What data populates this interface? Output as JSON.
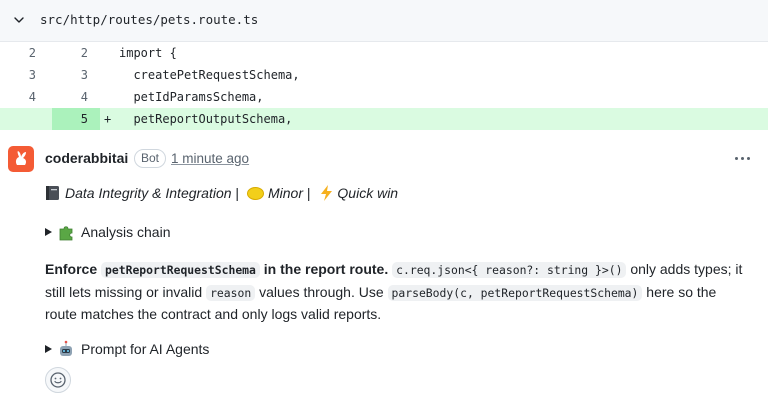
{
  "file": {
    "path": "src/http/routes/pets.route.ts",
    "icon": "chevron-down-icon"
  },
  "diff": {
    "lines": [
      {
        "old": "2",
        "new": "2",
        "marker": "",
        "code": "import {",
        "type": "context"
      },
      {
        "old": "3",
        "new": "3",
        "marker": "",
        "code": "  createPetRequestSchema,",
        "type": "context"
      },
      {
        "old": "4",
        "new": "4",
        "marker": "",
        "code": "  petIdParamsSchema,",
        "type": "context"
      },
      {
        "old": "",
        "new": "5",
        "marker": "+",
        "code": "  petReportOutputSchema,",
        "type": "added"
      }
    ],
    "colors": {
      "added_bg": "#dafbe1",
      "added_gutter": "#abf2bc"
    }
  },
  "comment": {
    "author": "coderabbitai",
    "badge": "Bot",
    "time": "1 minute ago",
    "avatar_color": "#f45b35",
    "tagline": {
      "category": "Data Integrity & Integration",
      "sep1": " | ",
      "severity": "Minor",
      "sep2": " | ",
      "effort": "Quick win",
      "icons": [
        "ledger-icon",
        "yellow-circle-icon",
        "lightning-icon"
      ]
    },
    "analysis_chain": "Analysis chain",
    "body": {
      "bold_lead": "Enforce ",
      "bold_code": "petReportRequestSchema",
      "bold_tail": " in the report route.",
      "code1": "c.req.json<{ reason?: string }>()",
      "text1": " only adds types; it still lets missing or invalid ",
      "code2": "reason",
      "text2": " values through. Use ",
      "code3": "parseBody(c, petReportRequestSchema)",
      "text3": " here so the route matches the contract and only logs valid reports."
    },
    "prompt_for_agents": "Prompt for AI Agents"
  }
}
